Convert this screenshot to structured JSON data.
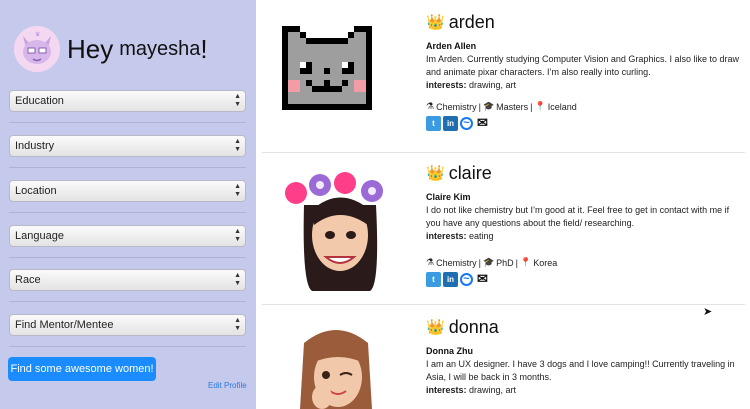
{
  "sidebar": {
    "greeting": "Hey",
    "username": "mayesha",
    "exclaim": "!",
    "filters": [
      "Education",
      "Industry",
      "Location",
      "Language",
      "Race",
      "Find Mentor/Mentee"
    ],
    "find_button": "Find some awesome women!",
    "edit_link": "Edit Profile"
  },
  "profiles": [
    {
      "handle": "arden",
      "full_name": "Arden Allen",
      "bio": "Im Arden. Currently studying Computer Vision and Graphics. I also like to draw and animate pixar characters. I’m also really into curling.",
      "interests_label": "interests:",
      "interests": "drawing, art",
      "field": "Chemistry",
      "degree": "Masters",
      "location": "Iceland"
    },
    {
      "handle": "claire",
      "full_name": "Claire Kim",
      "bio": "I do not like chemistry but I’m good at it. Feel free to get in contact with me if you have any questions about the field/ researching.",
      "interests_label": "interests:",
      "interests": "eating",
      "field": "Chemistry",
      "degree": "PhD",
      "location": "Korea"
    },
    {
      "handle": "donna",
      "full_name": "Donna Zhu",
      "bio": "I am an UX designer. I have 3 dogs and I love camping!! Currently traveling in Asia, I will be back in 3 months.",
      "interests_label": "interests:",
      "interests": "drawing, art"
    }
  ],
  "separator": "|",
  "social_labels": {
    "twitter": "t",
    "linkedin": "in"
  },
  "icons": {
    "crown": "crown-icon",
    "field": "flask-icon",
    "degree": "graduation-cap-icon",
    "location": "pin-icon",
    "twitter": "twitter-icon",
    "linkedin": "linkedin-icon",
    "messenger": "messenger-icon",
    "email": "email-icon"
  },
  "colors": {
    "sidebar_bg": "#c5c9ec",
    "button_bg": "#1a8cff",
    "link": "#2a7ae2"
  }
}
